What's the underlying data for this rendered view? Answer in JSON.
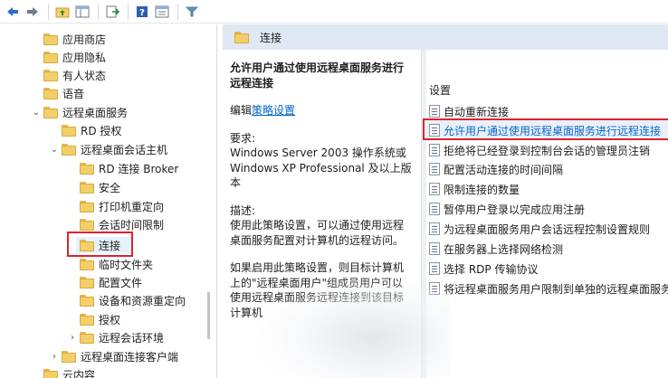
{
  "toolbar": {
    "buttons": [
      "back-icon",
      "forward-icon",
      "up-folder-icon",
      "show-hide-tree-icon",
      "export-icon",
      "help-icon",
      "properties-icon",
      "filter-icon"
    ]
  },
  "tree": {
    "items": [
      {
        "label": "应用商店"
      },
      {
        "label": "应用隐私"
      },
      {
        "label": "有人状态"
      },
      {
        "label": "语音"
      },
      {
        "label": "远程桌面服务",
        "expander": "⌄"
      },
      {
        "label": "RD 授权"
      },
      {
        "label": "远程桌面会话主机",
        "expander": "⌄"
      },
      {
        "label": "RD 连接 Broker"
      },
      {
        "label": "安全"
      },
      {
        "label": "打印机重定向"
      },
      {
        "label": "会话时间限制"
      },
      {
        "label": "连接"
      },
      {
        "label": "临时文件夹"
      },
      {
        "label": "配置文件"
      },
      {
        "label": "设备和资源重定向"
      },
      {
        "label": "授权"
      },
      {
        "label": "远程会话环境",
        "expander": "›"
      },
      {
        "label": "远程桌面连接客户端",
        "expander": "›"
      },
      {
        "label": "云内容"
      }
    ]
  },
  "right": {
    "header_title": "连接",
    "description": {
      "title": "允许用户通过使用远程桌面服务进行远程连接",
      "edit_prefix": "编辑",
      "edit_link": "策略设置",
      "requirements_label": "要求:",
      "requirements_text": "Windows Server 2003 操作系统或 Windows XP Professional 及以上版本",
      "description_label": "描述:",
      "description_text": "使用此策略设置，可以通过使用远程桌面服务配置对计算机的远程访问。",
      "if_enabled_text": "如果启用此策略设置，则目标计算机上的\"远程桌面用户\"组成员用户可以使用远程桌面服务远程连接到该目标计算机"
    },
    "settings_header": "设置",
    "settings": [
      {
        "label": "自动重新连接"
      },
      {
        "label": "允许用户通过使用远程桌面服务进行远程连接",
        "highlight": true
      },
      {
        "label": "拒绝将已经登录到控制台会话的管理员注销"
      },
      {
        "label": "配置活动连接的时间间隔"
      },
      {
        "label": "限制连接的数量"
      },
      {
        "label": "暂停用户登录以完成应用注册"
      },
      {
        "label": "为远程桌面服务用户会话远程控制设置规则"
      },
      {
        "label": "在服务器上选择网络检测"
      },
      {
        "label": "选择 RDP 传输协议"
      },
      {
        "label": "将远程桌面服务用户限制到单独的远程桌面服务会话"
      }
    ]
  }
}
